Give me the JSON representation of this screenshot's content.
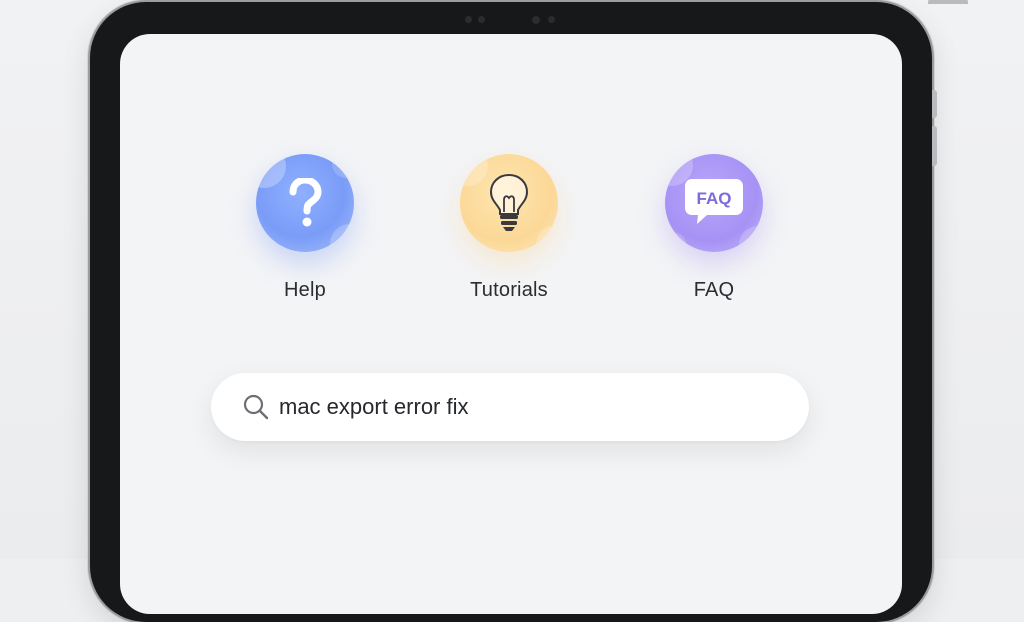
{
  "shortcuts": {
    "help": {
      "label": "Help",
      "icon": "question-icon",
      "color": "#7a9cf7"
    },
    "tutorials": {
      "label": "Tutorials",
      "icon": "lightbulb-icon",
      "color": "#fbd897"
    },
    "faq": {
      "label": "FAQ",
      "icon": "faq-chat-bubble-icon",
      "color": "#a692f4",
      "badge_text": "FAQ"
    }
  },
  "search": {
    "value": "mac export error fix",
    "icon": "search-icon"
  }
}
